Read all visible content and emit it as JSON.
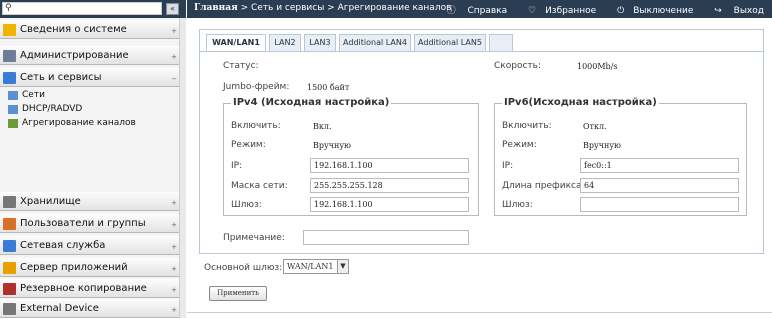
{
  "sidebar": {
    "collapse_glyph": "«",
    "items": [
      {
        "label": "Сведения о системе",
        "toggle": "+",
        "icon": "info-icon",
        "color": "#f0b400"
      },
      {
        "label": "Администрирование",
        "toggle": "+",
        "icon": "tools-icon",
        "color": "#6a7f95"
      },
      {
        "label": "Сеть и сервисы",
        "toggle": "−",
        "icon": "network-icon",
        "color": "#3a7bd5"
      },
      {
        "label": "Хранилище",
        "toggle": "+",
        "icon": "storage-icon",
        "color": "#777"
      },
      {
        "label": "Пользователи и группы",
        "toggle": "+",
        "icon": "users-icon",
        "color": "#d86f2a"
      },
      {
        "label": "Сетевая служба",
        "toggle": "+",
        "icon": "network-service-icon",
        "color": "#3a7bd5"
      },
      {
        "label": "Сервер приложений",
        "toggle": "+",
        "icon": "app-server-icon",
        "color": "#e8a000"
      },
      {
        "label": "Резервное копирование",
        "toggle": "+",
        "icon": "backup-icon",
        "color": "#b03030"
      },
      {
        "label": "External Device",
        "toggle": "+",
        "icon": "external-device-icon",
        "color": "#777"
      }
    ],
    "subitems": [
      {
        "label": "Сети",
        "icon": "network-icon"
      },
      {
        "label": "DHCP/RADVD",
        "icon": "dhcp-icon"
      },
      {
        "label": "Агрегирование каналов",
        "icon": "link-aggregation-icon"
      }
    ]
  },
  "topbar": {
    "home": "Главная",
    "path": " > Сеть и сервисы > Агрегирование каналов",
    "help": "Справка",
    "favorites": "Избранное",
    "shutdown": "Выключение",
    "logout": "Выход"
  },
  "tabs": [
    "WAN/LAN1",
    "LAN2",
    "LAN3",
    "Additional LAN4",
    "Additional LAN5",
    ""
  ],
  "status": {
    "status_label": "Статус:",
    "speed_label": "Скорость:",
    "speed_value": "1000Mb/s",
    "jumbo_label": "Jumbo-фрейм:",
    "jumbo_value": "1500 байт"
  },
  "ipv4": {
    "title": "IPv4 (Исходная настройка)",
    "enable_label": "Включить:",
    "enable_value": "Вкл.",
    "mode_label": "Режим:",
    "mode_value": "Вручную",
    "ip_label": "IP:",
    "ip_value": "192.168.1.100",
    "mask_label": "Маска сети:",
    "mask_value": "255.255.255.128",
    "gw_label": "Шлюз:",
    "gw_value": "192.168.1.100"
  },
  "ipv6": {
    "title": "IPv6(Исходная настройка)",
    "enable_label": "Включить:",
    "enable_value": "Откл.",
    "mode_label": "Режим:",
    "mode_value": "Вручную",
    "ip_label": "IP:",
    "ip_value": "fec0::1",
    "prefix_label": "Длина префикса:",
    "prefix_value": "64",
    "gw_label": "Шлюз:",
    "gw_value": ""
  },
  "note_label": "Примечание:",
  "note_value": "",
  "gateway_label": "Основной шлюз:",
  "gateway_value": "WAN/LAN1",
  "apply_label": "Применить"
}
